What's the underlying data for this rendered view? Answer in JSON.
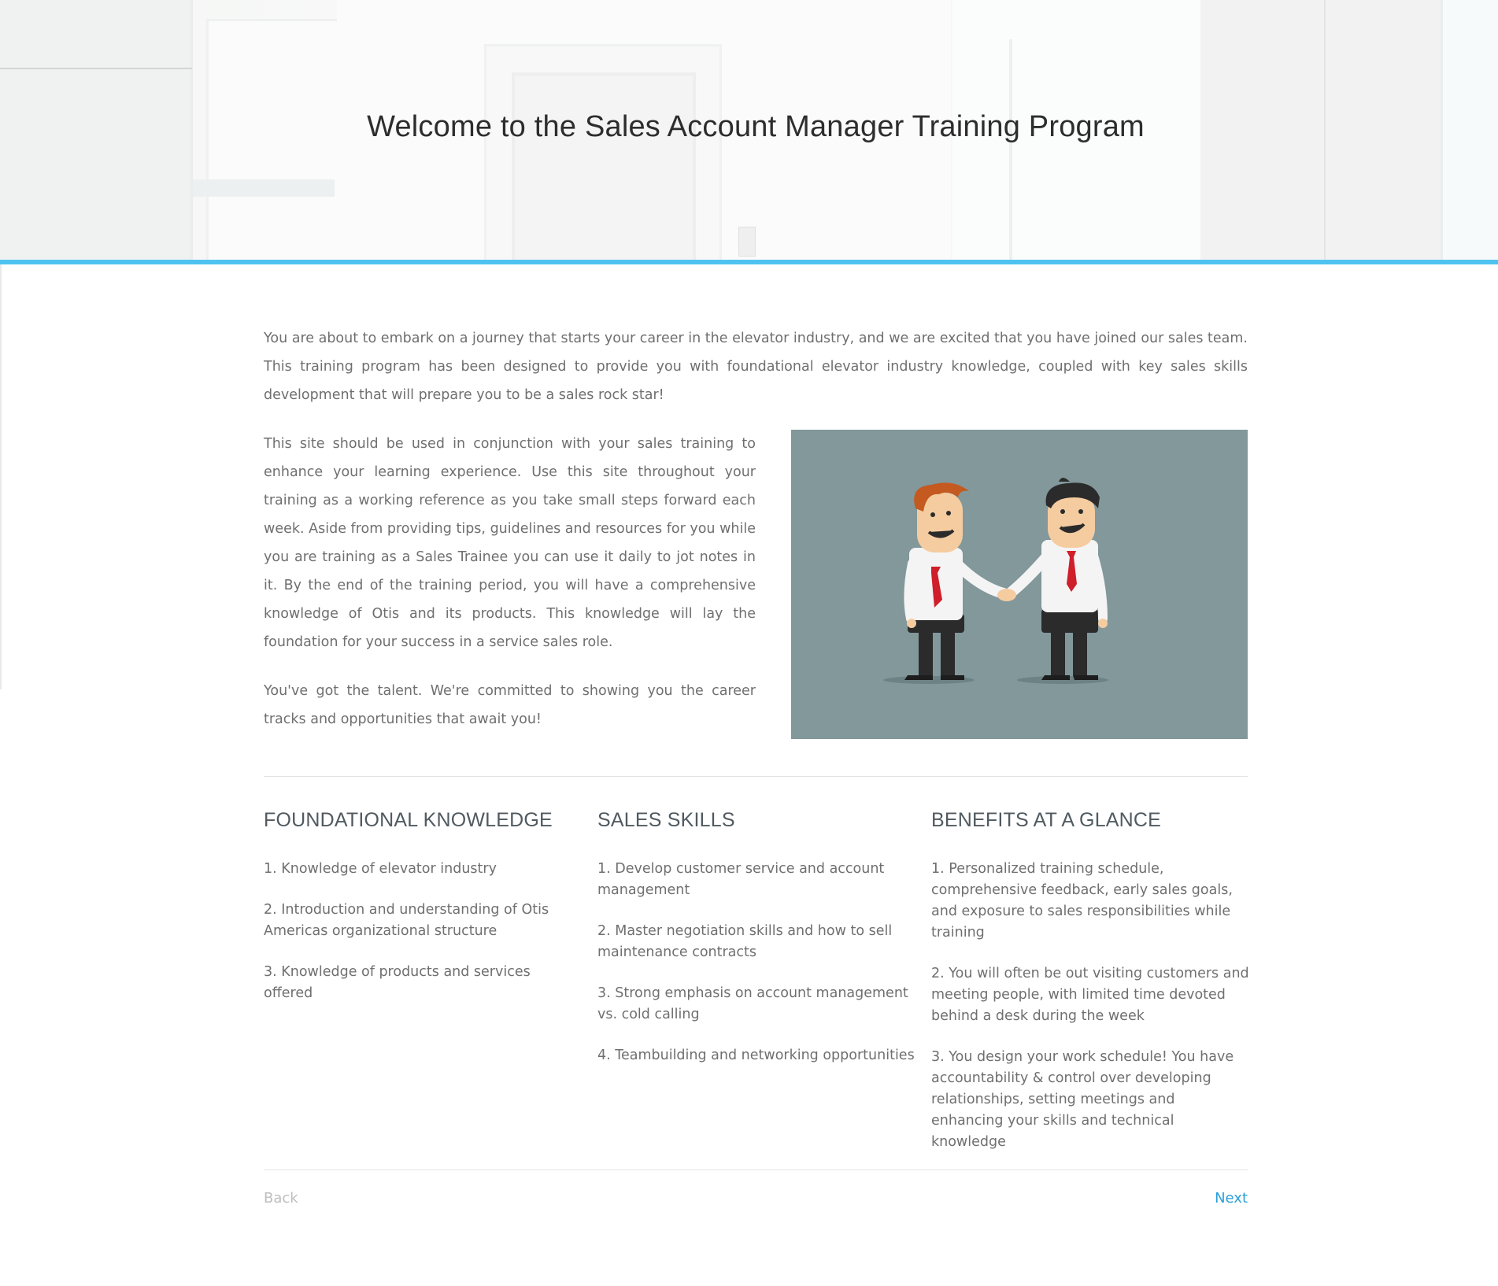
{
  "hero": {
    "title": "Welcome to the Sales Account Manager Training Program",
    "accent_color": "#4fc3f0"
  },
  "intro": {
    "text": "You are about to embark on a journey that starts your career in the elevator industry, and we are excited that you have joined our sales team. This training program has been designed to provide you with foundational elevator industry knowledge, coupled with key sales skills development that will prepare you to be a sales rock star!"
  },
  "body": {
    "paragraph1": "This site should be used in conjunction with your sales training to enhance your learning experience. Use this site throughout your training as a working reference as you take small steps forward each week. Aside from providing tips, guidelines and resources for you while you are training as a Sales Trainee you can use it daily to jot notes in it. By the end of the training period, you will have a comprehensive knowledge of Otis and its products. This knowledge will lay the foundation for your success in a service sales role.",
    "paragraph2": "You've got the talent. We're committed to showing you the career tracks and opportunities that await you!"
  },
  "illustration": {
    "icon": "handshake-illustration",
    "background": "#82989b"
  },
  "sections": [
    {
      "heading": "FOUNDATIONAL KNOWLEDGE",
      "items": [
        "1. Knowledge of elevator industry",
        "2. Introduction and understanding of Otis Americas organizational structure",
        "3. Knowledge of products and services offered"
      ]
    },
    {
      "heading": "SALES SKILLS",
      "items": [
        "1. Develop customer service and account management",
        "2. Master negotiation skills and how to sell maintenance contracts",
        "3. Strong emphasis on account management vs. cold calling",
        "4. Teambuilding and networking opportunities"
      ]
    },
    {
      "heading": "BENEFITS AT A GLANCE",
      "items": [
        "1. Personalized training schedule, comprehensive feedback, early sales goals, and exposure to sales responsibilities while training",
        "2. You will often be out visiting customers and meeting people, with limited time devoted behind a desk during the week",
        "3. You design your work schedule! You have accountability & control over developing relationships, setting meetings and enhancing your skills and technical knowledge"
      ]
    }
  ],
  "nav": {
    "back_label": "Back",
    "next_label": "Next",
    "next_color": "#2b9fd8"
  }
}
